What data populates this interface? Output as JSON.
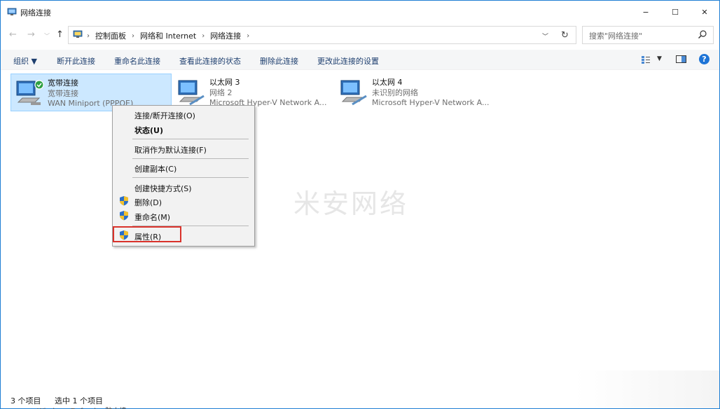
{
  "window": {
    "title": "网络连接",
    "controls": {
      "minimize": "−",
      "maximize": "☐",
      "close": "✕"
    }
  },
  "address": {
    "breadcrumbs": [
      "控制面板",
      "网络和 Internet",
      "网络连接"
    ],
    "search_placeholder": "搜索\"网络连接\""
  },
  "toolbar": {
    "organize": "组织 ▼",
    "disconnect": "断开此连接",
    "rename": "重命名此连接",
    "view_status": "查看此连接的状态",
    "delete": "删除此连接",
    "change_settings": "更改此连接的设置",
    "help": "?"
  },
  "connections": [
    {
      "name": "宽带连接",
      "status": "宽带连接",
      "device": "WAN Miniport (PPPOE)"
    },
    {
      "name": "以太网 3",
      "status": "网络 2",
      "device": "Microsoft Hyper-V Network A..."
    },
    {
      "name": "以太网 4",
      "status": "未识别的网络",
      "device": "Microsoft Hyper-V Network A..."
    }
  ],
  "context_menu": {
    "connect": "连接/断开连接(O)",
    "status": "状态(U)",
    "cancel_default": "取消作为默认连接(F)",
    "copy": "创建副本(C)",
    "shortcut": "创建快捷方式(S)",
    "delete": "删除(D)",
    "rename": "重命名(M)",
    "properties": "属性(R)"
  },
  "watermark": "米安网络",
  "statusbar": {
    "count": "3 个项目",
    "selected": "选中 1 个项目"
  },
  "ghost_text": "Windows Defender 防火墙",
  "colors": {
    "accent": "#1e74d6",
    "selection": "#cce8ff",
    "highlight": "#d9322b"
  }
}
